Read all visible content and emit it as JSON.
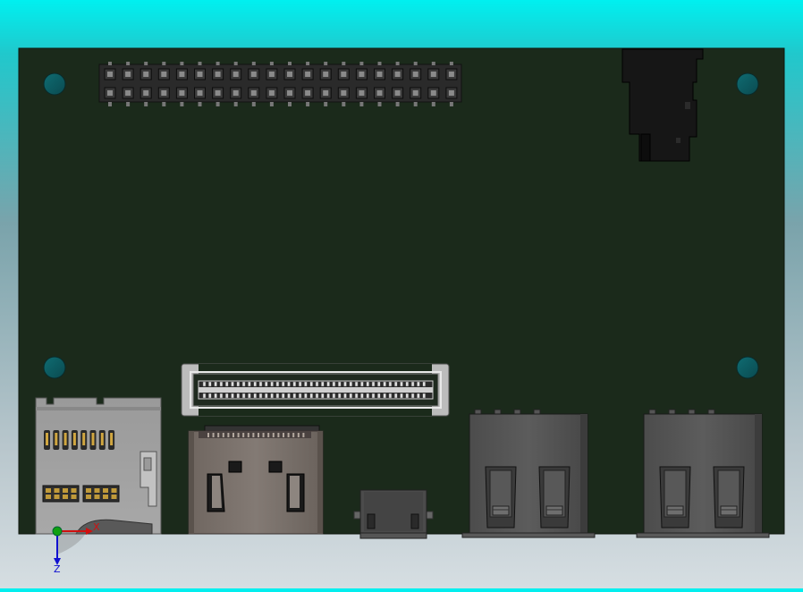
{
  "scene": {
    "board_color": "#1b2a1b",
    "background_top": "#00f0f0",
    "background_bottom": "#d6dee2",
    "components": [
      "pin-header-2x20",
      "audio-jack",
      "board-to-board-connector",
      "microsd-card-slot",
      "hdmi-connector",
      "micro-usb-connector",
      "usb-a-connector-1",
      "usb-a-connector-2",
      "mounting-hole"
    ]
  },
  "triad": {
    "x_label": "X",
    "z_label": "Z",
    "x_color": "#d01010",
    "y_color": "#10a010",
    "z_color": "#1010d0"
  }
}
